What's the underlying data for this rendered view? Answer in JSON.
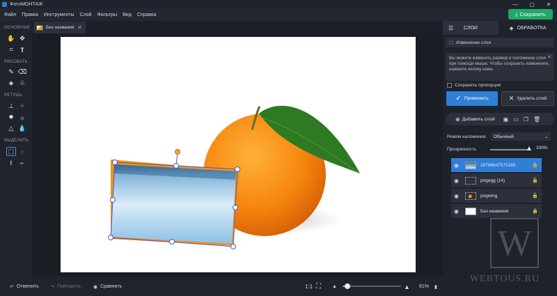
{
  "window": {
    "title": "ФотоМОНТАЖ",
    "controls": [
      "—",
      "▢",
      "✕"
    ]
  },
  "menu": [
    "Файл",
    "Правка",
    "Инструменты",
    "Слой",
    "Фильтры",
    "Вид",
    "Справка"
  ],
  "save_button": {
    "label": "Сохранить"
  },
  "toolbar": {
    "groups": [
      "ОСНОВНЫЕ",
      "РИСОВАТЬ",
      "РЕТУШЬ",
      "ВЫДЕЛИТЬ"
    ]
  },
  "doc_tab": {
    "label": "Без названия",
    "close": "✕"
  },
  "bottom": {
    "undo": "Отменить",
    "redo": "Повторить",
    "compare": "Сравнить",
    "one_to_one": "1:1",
    "zoom": "81%",
    "zoom_level": 0.81
  },
  "right_panel": {
    "tabs": [
      "СЛОИ",
      "ОБРАБОТКА"
    ],
    "layer_mode": "Изменение слоя",
    "hint": "Вы можете изменить размер и положение слоя при помощи мыши. Чтобы сохранить изменения, нажмите кнопку ниже.",
    "keep_proportions": "Сохранять пропорции",
    "apply": "Применить",
    "delete_layer": "Удалить слой",
    "add_layer": "Добавить слой",
    "blend_label": "Режим наложения:",
    "blend_value": "Обычный",
    "opacity_label": "Прозрачность",
    "opacity_value": "100%",
    "layers": [
      {
        "name": "28766b47575285",
        "selected": true
      },
      {
        "name": "pngegg (14)",
        "selected": false
      },
      {
        "name": "pngwing",
        "selected": false
      },
      {
        "name": "Без названия",
        "selected": false
      }
    ]
  },
  "watermark": {
    "letter": "W",
    "text": "WEBTOUS.RU"
  },
  "colors": {
    "accent": "#2f7fd6",
    "save": "#20a867",
    "bg": "#1b1f27"
  }
}
